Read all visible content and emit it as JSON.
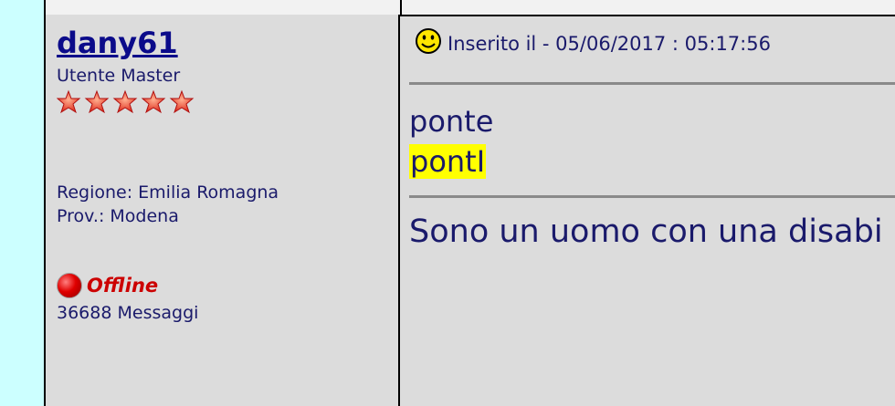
{
  "author": {
    "username": "dany61",
    "rank": "Utente Master",
    "star_count": 5,
    "region": "Regione: Emilia Romagna",
    "province": "Prov.: Modena",
    "status": "Offline",
    "message_count": "36688 Messaggi"
  },
  "post": {
    "icon": "smiley-icon",
    "posted_label": "Inserito il - 05/06/2017 :  05:17:56",
    "line1": "ponte",
    "line2": "pontI",
    "signature": "Sono un uomo con una disabi"
  },
  "colors": {
    "page_bg": "#ccffff",
    "cell_bg": "#dcdcdc",
    "text": "#1a1a6b",
    "link": "#0b0b8a",
    "highlight": "#ffff00",
    "offline": "#cc0000"
  }
}
